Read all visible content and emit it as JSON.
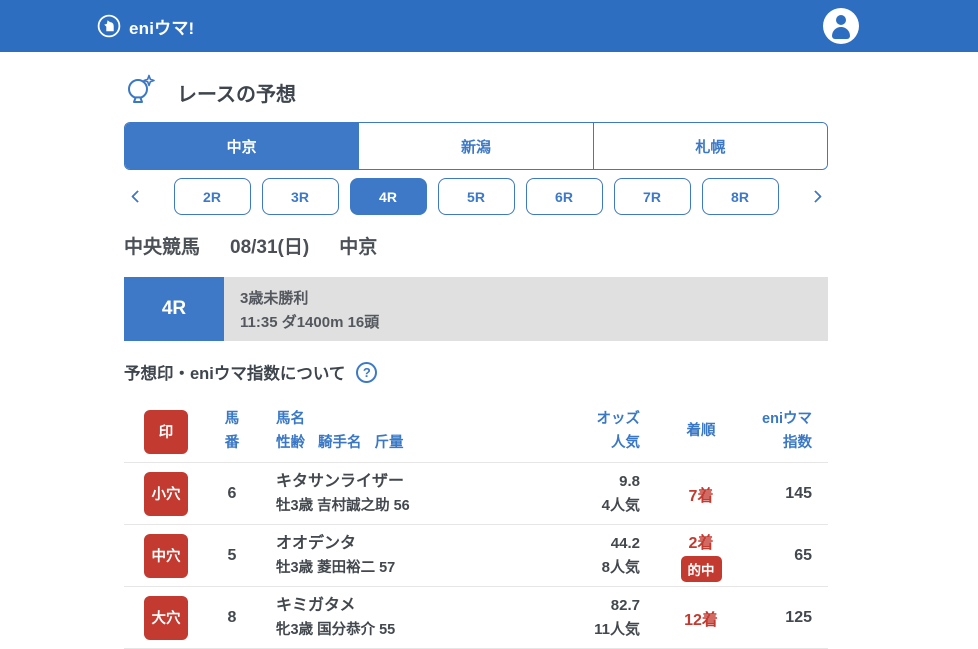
{
  "colors": {
    "header_blue": "#2d6ec1",
    "accent_blue": "#3d79c6",
    "header_text_blue": "#3a78c5",
    "mark_red": "#c23a30",
    "info_gray": "#e0e0e0",
    "text_dark": "#43484e"
  },
  "appbar": {
    "logo_text": "eniウマ!",
    "logo_icon": "horse-in-circle-icon",
    "user_icon": "person-icon"
  },
  "section": {
    "title": "レースの予想",
    "icon": "crystal-ball-icon"
  },
  "venue_tabs": [
    {
      "label": "中京",
      "selected": true
    },
    {
      "label": "新潟",
      "selected": false
    },
    {
      "label": "札幌",
      "selected": false
    }
  ],
  "race_nav": {
    "prev_icon": "chevron-left-icon",
    "next_icon": "chevron-right-icon",
    "races": [
      {
        "label": "2R",
        "selected": false
      },
      {
        "label": "3R",
        "selected": false
      },
      {
        "label": "4R",
        "selected": true
      },
      {
        "label": "5R",
        "selected": false
      },
      {
        "label": "6R",
        "selected": false
      },
      {
        "label": "7R",
        "selected": false
      },
      {
        "label": "8R",
        "selected": false
      }
    ]
  },
  "race_meta": {
    "organization": "中央競馬",
    "date": "08/31(日)",
    "venue": "中京"
  },
  "race_info": {
    "race_no": "4R",
    "condition": "3歳未勝利",
    "details": "11:35 ダ1400m 16頭"
  },
  "about": {
    "label": "予想印・eniウマ指数について",
    "help_glyph": "?"
  },
  "table": {
    "headers": {
      "mark": "印",
      "number_line1": "馬",
      "number_line2": "番",
      "name_line1": "馬名",
      "name_line2": "性齢 騎手名 斤量",
      "odds_line1": "オッズ",
      "odds_line2": "人気",
      "result": "着順",
      "index_line1": "eniウマ",
      "index_line2": "指数"
    },
    "rows": [
      {
        "mark": "小穴",
        "number": "6",
        "name": "キタサンライザー",
        "detail": "牡3歳 吉村誠之助 56",
        "odds": "9.8",
        "popularity": "4人気",
        "result": "7着",
        "hit": "",
        "index": "145"
      },
      {
        "mark": "中穴",
        "number": "5",
        "name": "オオデンタ",
        "detail": "牡3歳 菱田裕二 57",
        "odds": "44.2",
        "popularity": "8人気",
        "result": "2着",
        "hit": "的中",
        "index": "65"
      },
      {
        "mark": "大穴",
        "number": "8",
        "name": "キミガタメ",
        "detail": "牝3歳 国分恭介 55",
        "odds": "82.7",
        "popularity": "11人気",
        "result": "12着",
        "hit": "",
        "index": "125"
      }
    ]
  }
}
